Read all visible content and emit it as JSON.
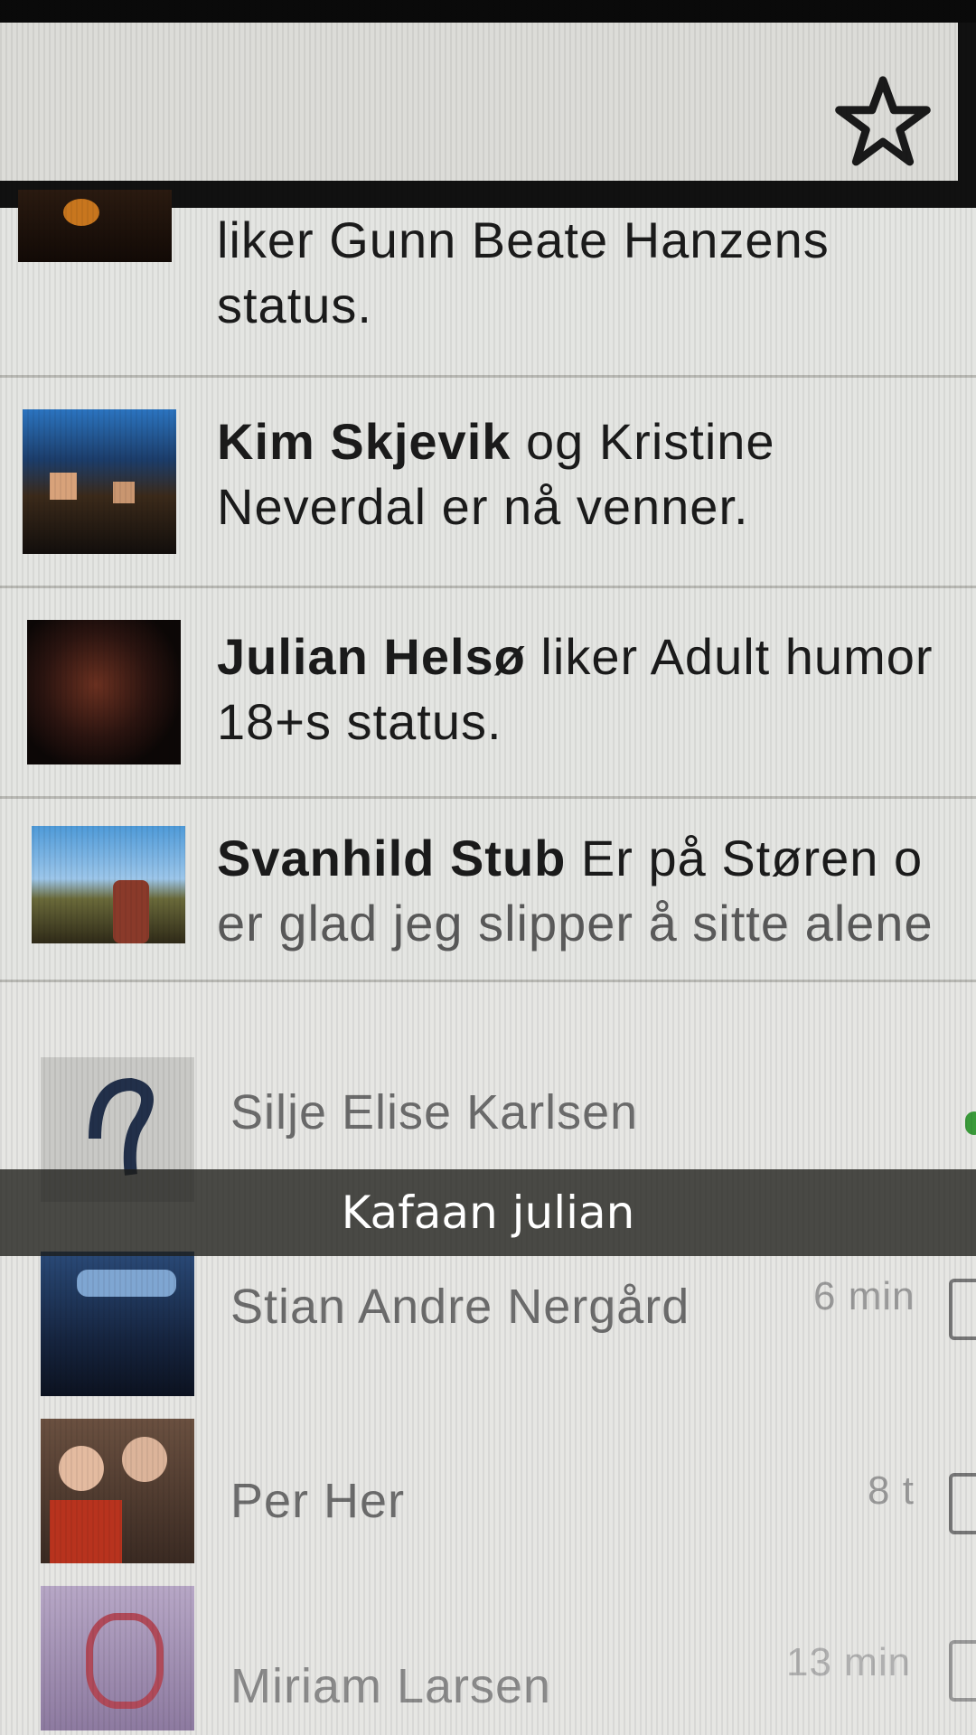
{
  "feed": [
    {
      "name": "",
      "action": "liker Gunn Beate Hanzens",
      "line2": "status."
    },
    {
      "name": "Kim Skjevik",
      "action": " og Kristine",
      "line2": "Neverdal er nå venner."
    },
    {
      "name": "Julian Helsø",
      "action": " liker Adult humor",
      "line2": "18+s status."
    },
    {
      "name": "Svanhild Stub",
      "action": " Er på Støren o",
      "line2": "er glad jeg slipper å sitte alene"
    }
  ],
  "chats": [
    {
      "name": "Silje Elise Karlsen",
      "time": ""
    },
    {
      "name": "Stian Andre Nergård",
      "time": "6 min"
    },
    {
      "name": "Per Her",
      "time": "8 t"
    },
    {
      "name": "Miriam Larsen",
      "time": "13 min"
    }
  ],
  "caption": "Kafaan julian",
  "colors": {
    "background": "#e4e5e2",
    "caption_bg": "#1c1c18",
    "online": "#3a9a3a"
  }
}
